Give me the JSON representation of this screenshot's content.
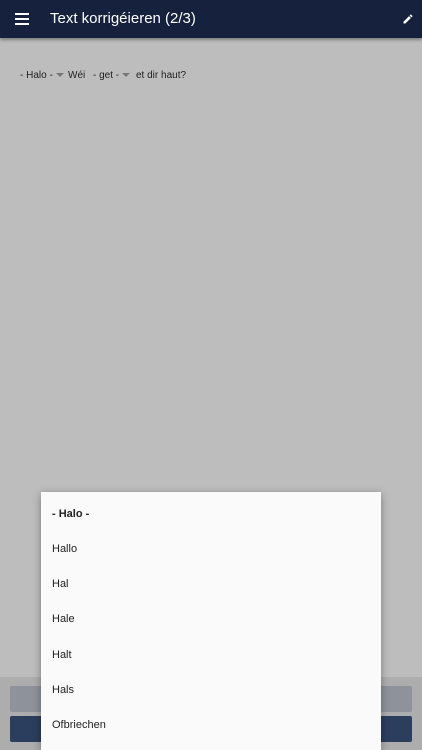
{
  "header": {
    "title": "Text korrigéieren (2/3)",
    "menu_icon": "hamburger-menu-icon",
    "edit_icon": "pencil-icon"
  },
  "sentence": {
    "dropdown_1": "- Halo -",
    "word_1": "Wéi",
    "dropdown_2": "- get -",
    "word_2": "et dir haut?"
  },
  "dropdown_menu": {
    "options": [
      "- Halo -",
      "Hallo",
      "Hal",
      "Hale",
      "Halt",
      "Hals",
      "Ofbriechen"
    ],
    "selected": "- Halo -"
  },
  "colors": {
    "appbar": "#15213d",
    "background": "#bdbdbd",
    "primary_button": "#2c3e5e",
    "secondary_button": "#8e939b",
    "menu_background": "#fafafa"
  }
}
